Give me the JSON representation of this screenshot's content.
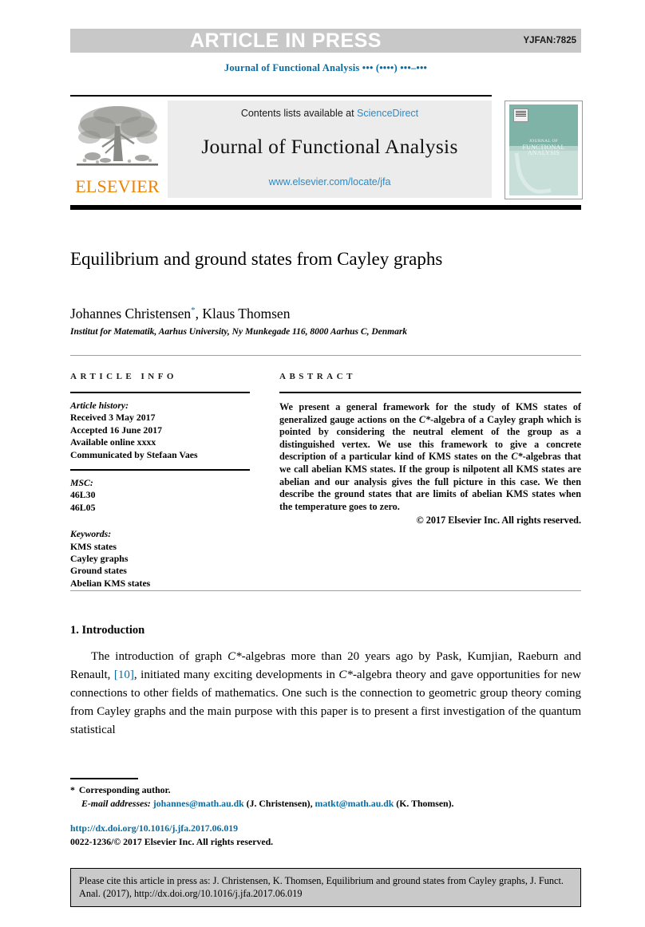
{
  "banner": {
    "article_in_press": "ARTICLE IN PRESS",
    "manuscript_code": "YJFAN:7825"
  },
  "running_head": "Journal of Functional Analysis ••• (••••) •••–•••",
  "masthead": {
    "contents_prefix": "Contents lists available at ",
    "contents_link": "ScienceDirect",
    "journal_name": "Journal of Functional Analysis",
    "journal_url": "www.elsevier.com/locate/jfa",
    "publisher_wordmark": "ELSEVIER",
    "cover": {
      "line1": "JOURNAL OF",
      "line2": "FUNCTIONAL",
      "line3": "ANALYSIS"
    }
  },
  "article": {
    "title": "Equilibrium and ground states from Cayley graphs",
    "authors": "Johannes Christensen",
    "author_marker": "*",
    "authors_rest": ", Klaus Thomsen",
    "affiliation": "Institut for Matematik, Aarhus University, Ny Munkegade 116, 8000 Aarhus C, Denmark"
  },
  "info": {
    "heading": "ARTICLE INFO",
    "history_label": "Article history:",
    "history": [
      "Received 3 May 2017",
      "Accepted 16 June 2017",
      "Available online xxxx",
      "Communicated by Stefaan Vaes"
    ],
    "msc_label": "MSC:",
    "msc": [
      "46L30",
      "46L05"
    ],
    "keywords_label": "Keywords:",
    "keywords": [
      "KMS states",
      "Cayley graphs",
      "Ground states",
      "Abelian KMS states"
    ]
  },
  "abstract": {
    "heading": "ABSTRACT",
    "p1_a": "We present a general framework for the study of KMS states of generalized gauge actions on the ",
    "p1_math1": "C*",
    "p1_b": "-algebra of a Cayley graph which is pointed by considering the neutral element of the group as a distinguished vertex. We use this framework to give a concrete description of a particular kind of KMS states on the ",
    "p1_math2": "C*",
    "p1_c": "-algebras that we call abelian KMS states. If the group is nilpotent all KMS states are abelian and our analysis gives the full picture in this case. We then describe the ground states that are limits of abelian KMS states when the temperature goes to zero.",
    "copyright": "© 2017 Elsevier Inc. All rights reserved."
  },
  "body": {
    "section_number_title": "1. Introduction",
    "p1_a": "The introduction of graph ",
    "p1_math1": "C*",
    "p1_b": "-algebras more than 20 years ago by Pask, Kumjian, Raeburn and Renault, ",
    "p1_cite": "[10]",
    "p1_c": ", initiated many exciting developments in ",
    "p1_math2": "C*",
    "p1_d": "-algebra theory and gave opportunities for new connections to other fields of mathematics. One such is the connection to geometric group theory coming from Cayley graphs and the main purpose with this paper is to present a first investigation of the quantum statistical"
  },
  "footnotes": {
    "corresponding_marker": "*",
    "corresponding_text": "Corresponding author.",
    "email_label": "E-mail addresses:",
    "email1": "johannes@math.au.dk",
    "email1_owner": "(J. Christensen),",
    "email2": "matkt@math.au.dk",
    "email2_owner": "(K. Thomsen).",
    "doi": "http://dx.doi.org/10.1016/j.jfa.2017.06.019",
    "issn_line": "0022-1236/© 2017 Elsevier Inc. All rights reserved."
  },
  "cite_box": {
    "text": "Please cite this article in press as: J. Christensen, K. Thomsen, Equilibrium and ground states from Cayley graphs, J. Funct. Anal. (2017), http://dx.doi.org/10.1016/j.jfa.2017.06.019"
  },
  "colors": {
    "link_blue": "#0b6ba0",
    "sd_blue": "#2b8bc6",
    "elsevier_orange": "#ef8200",
    "banner_gray": "#c8c8c8",
    "cover_teal": "#7fb3a8"
  }
}
